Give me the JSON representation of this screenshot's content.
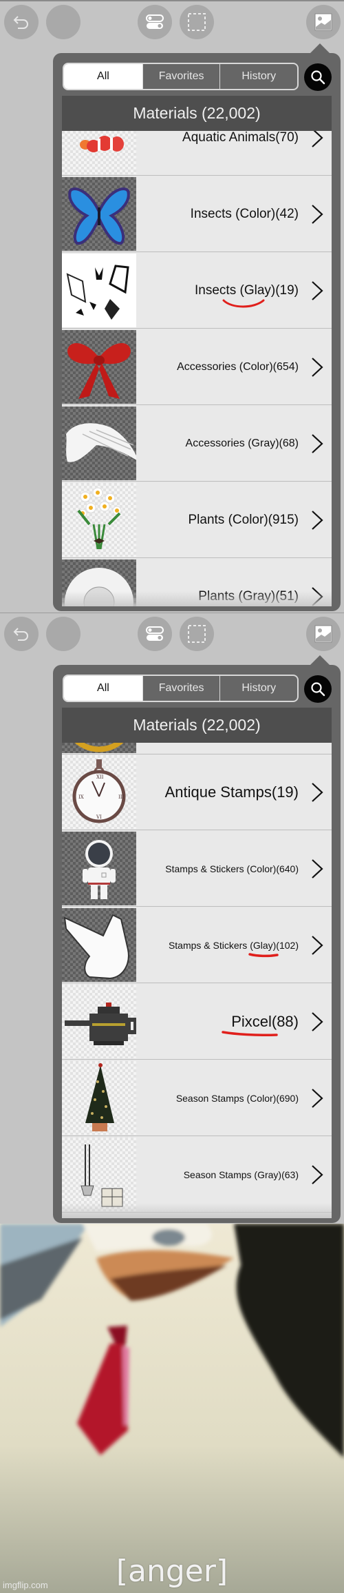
{
  "toolbar": {
    "buttons": [
      "undo",
      "blank",
      "toggle-layers",
      "selection",
      "material"
    ]
  },
  "tabs": [
    {
      "label": "All",
      "active": true
    },
    {
      "label": "Favorites",
      "active": false
    },
    {
      "label": "History",
      "active": false
    }
  ],
  "header": {
    "title": "Materials (22,002)"
  },
  "panel1": {
    "rows": [
      {
        "label": "Aquatic Animals(70)",
        "thumb": "clownfish"
      },
      {
        "label": "Insects (Color)(42)",
        "thumb": "blue-butterfly"
      },
      {
        "label": "Insects (Glay)(19)",
        "thumb": "butterfly-sketches",
        "annotated": "Glay"
      },
      {
        "label": "Accessories (Color)(654)",
        "thumb": "red-bow"
      },
      {
        "label": "Accessories (Gray)(68)",
        "thumb": "white-wing"
      },
      {
        "label": "Plants (Color)(915)",
        "thumb": "daisy-bouquet"
      },
      {
        "label": "Plants (Gray)(51)",
        "thumb": "white-flower"
      }
    ]
  },
  "panel2": {
    "rows": [
      {
        "label": "",
        "thumb": "golden-crest"
      },
      {
        "label": "Antique Stamps(19)",
        "thumb": "pocket-watch"
      },
      {
        "label": "Stamps & Stickers (Color)(640)",
        "thumb": "astronaut"
      },
      {
        "label": "Stamps & Stickers (Glay)(102)",
        "thumb": "pointing-hand",
        "annotated": "Glay"
      },
      {
        "label": "Pixcel(88)",
        "thumb": "pixel-teapot",
        "annotated": "Pixcel"
      },
      {
        "label": "Season Stamps (Color)(690)",
        "thumb": "christmas-tree"
      },
      {
        "label": "Season Stamps (Gray)(63)",
        "thumb": "bell-and-gift"
      }
    ]
  },
  "annotation_color": "#e0201c",
  "meme": {
    "caption": "[anger]",
    "watermark": "imgflip.com"
  }
}
